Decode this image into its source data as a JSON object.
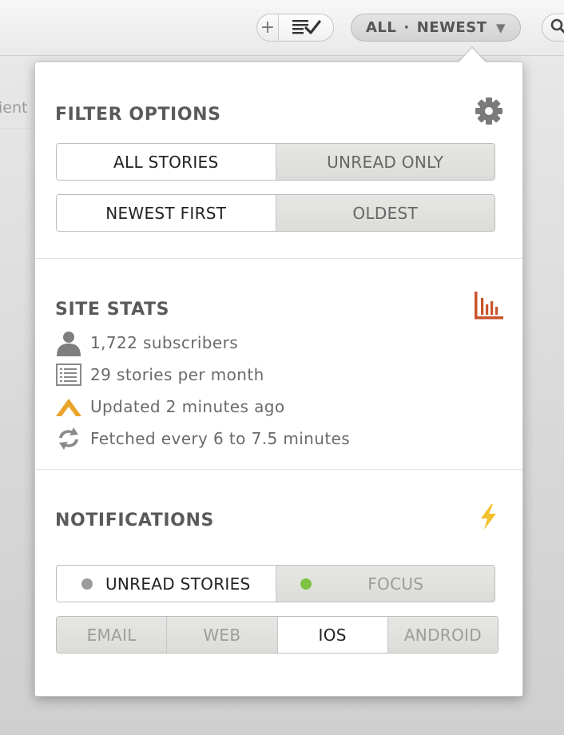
{
  "toolbar": {
    "add_label": "+",
    "filter_all": "ALL",
    "filter_sep": "·",
    "filter_newest": "NEWEST",
    "partial_text": "ient"
  },
  "filter_options": {
    "heading": "FILTER OPTIONS",
    "read_toggle": [
      "ALL STORIES",
      "UNREAD ONLY"
    ],
    "order_toggle": [
      "NEWEST FIRST",
      "OLDEST"
    ]
  },
  "site_stats": {
    "heading": "SITE STATS",
    "subscribers": "1,722 subscribers",
    "stories": "29 stories per month",
    "updated": "Updated 2 minutes ago",
    "fetched": "Fetched every 6 to 7.5 minutes"
  },
  "notifications": {
    "heading": "NOTIFICATIONS",
    "mode_toggle": [
      "UNREAD STORIES",
      "FOCUS"
    ],
    "channels": [
      "EMAIL",
      "WEB",
      "IOS",
      "ANDROID"
    ]
  },
  "colors": {
    "chart_icon": "#c9532b",
    "bolt_icon": "#f2c12e",
    "updated_icon": "#e9a52a",
    "focus_led": "#7fc243",
    "unread_led": "#9b9b9b"
  }
}
